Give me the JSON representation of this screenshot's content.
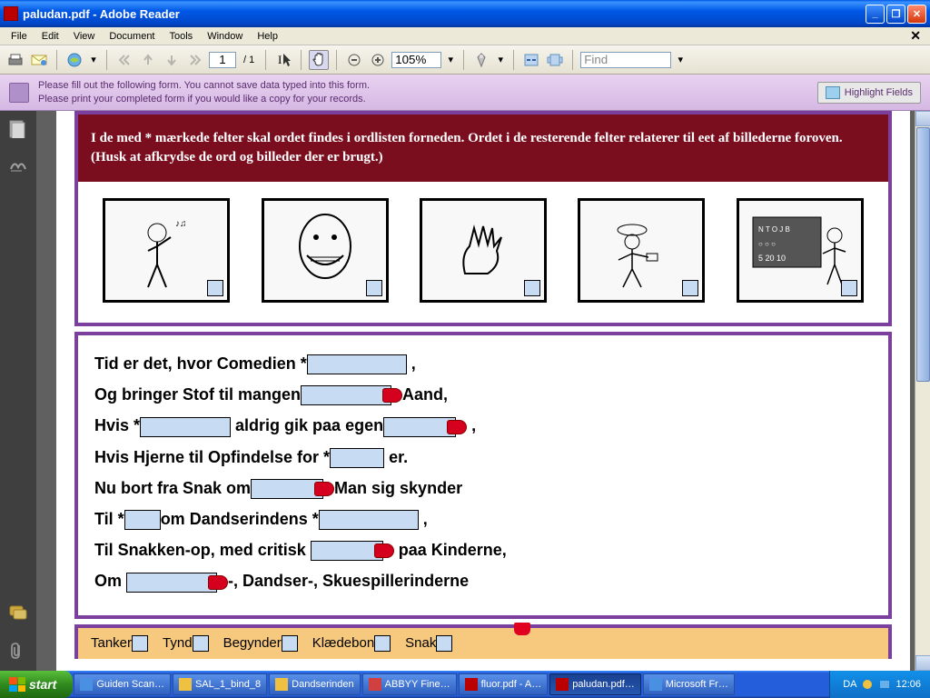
{
  "window": {
    "title": "paludan.pdf - Adobe Reader"
  },
  "menu": {
    "file": "File",
    "edit": "Edit",
    "view": "View",
    "document": "Document",
    "tools": "Tools",
    "window": "Window",
    "help": "Help"
  },
  "toolbar": {
    "page_cur": "1",
    "page_sep": "/ 1",
    "zoom": "105%",
    "find": "Find"
  },
  "formbar": {
    "line1": "Please fill out the following form. You cannot save data typed into this form.",
    "line2": "Please print your completed form if you would like a copy for your records.",
    "highlight": "Highlight Fields"
  },
  "doc": {
    "instructions": "I de med * mærkede felter skal ordet findes i ordlisten forneden. Ordet i de resterende felter relaterer til eet af billederne foroven.  (Husk at afkrydse de ord og billeder der er brugt.)",
    "lines": {
      "l1a": "Tid er det, hvor Comedien *",
      "l1b": " ,",
      "l2a": "Og bringer Stof til mangen",
      "l2b": "Aand,",
      "l3a": "Hvis *",
      "l3b": " aldrig gik paa egen",
      "l3c": " ,",
      "l4a": "Hvis Hjerne til Opfindelse for *",
      "l4b": "  er.",
      "l5a": "Nu bort fra Snak om",
      "l5b": "Man sig skynder",
      "l6a": "Til *",
      "l6b": "om Dandserindens *",
      "l6c": " ,",
      "l7a": "Til Snakken-op, med critisk ",
      "l7b": " paa Kinderne,",
      "l8a": "Om  ",
      "l8b": "-, Dandser-, Skuespillerinderne"
    },
    "wordbank": {
      "w1": "Tanker",
      "w2": "Tynd",
      "w3": "Begynder",
      "w4": "Klædebon",
      "w5": "Snak"
    }
  },
  "taskbar": {
    "start": "start",
    "items": [
      "Guiden Scan…",
      "SAL_1_bind_8",
      "Dandserinden",
      "ABBYY Fine…",
      "fluor.pdf - A…",
      "paludan.pdf…",
      "Microsoft Fr…"
    ],
    "tray": {
      "da": "DA",
      "time": "12:06"
    }
  }
}
